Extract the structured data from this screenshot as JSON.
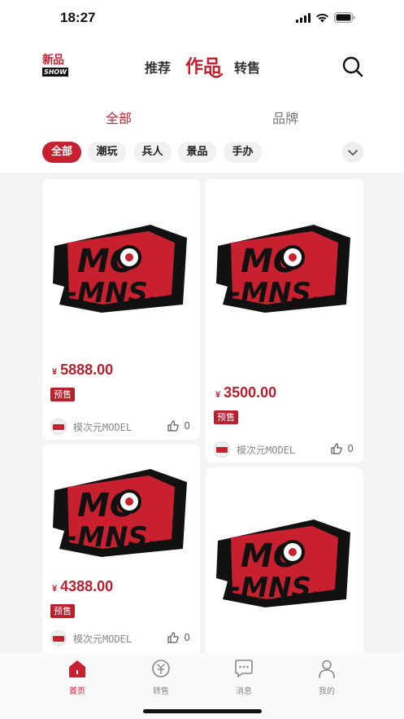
{
  "status_bar": {
    "time": "18:27"
  },
  "header": {
    "logo_top": "新品",
    "logo_bottom": "SHOW",
    "tabs": [
      {
        "label": "推荐",
        "active": false
      },
      {
        "label": "作品",
        "active": true
      },
      {
        "label": "转售",
        "active": false
      }
    ],
    "search_icon": "search-icon"
  },
  "sub_tabs": [
    {
      "label": "全部",
      "active": true
    },
    {
      "label": "品牌",
      "active": false
    }
  ],
  "categories": [
    {
      "label": "全部",
      "active": true
    },
    {
      "label": "潮玩",
      "active": false
    },
    {
      "label": "兵人",
      "active": false
    },
    {
      "label": "景品",
      "active": false
    },
    {
      "label": "手办",
      "active": false
    }
  ],
  "products": [
    {
      "currency": "¥",
      "price": "5888.00",
      "tag": "预售",
      "author": "模次元MODEL",
      "likes": "0",
      "logo_text": "MO MNS"
    },
    {
      "currency": "¥",
      "price": "3500.00",
      "tag": "预售",
      "author": "模次元MODEL",
      "likes": "0",
      "logo_text": "MO MNS"
    },
    {
      "currency": "¥",
      "price": "4388.00",
      "tag": "预售",
      "author": "模次元MODEL",
      "likes": "0",
      "logo_text": "MO MNS"
    },
    {
      "logo_text": "MO MNS"
    }
  ],
  "bottom_nav": [
    {
      "label": "首页",
      "icon": "home-icon",
      "active": true
    },
    {
      "label": "转售",
      "icon": "resale-icon",
      "active": false
    },
    {
      "label": "消息",
      "icon": "message-icon",
      "active": false
    },
    {
      "label": "我的",
      "icon": "profile-icon",
      "active": false
    }
  ],
  "colors": {
    "accent": "#c8202f",
    "price": "#b8202c",
    "background": "#f4f4f4"
  }
}
